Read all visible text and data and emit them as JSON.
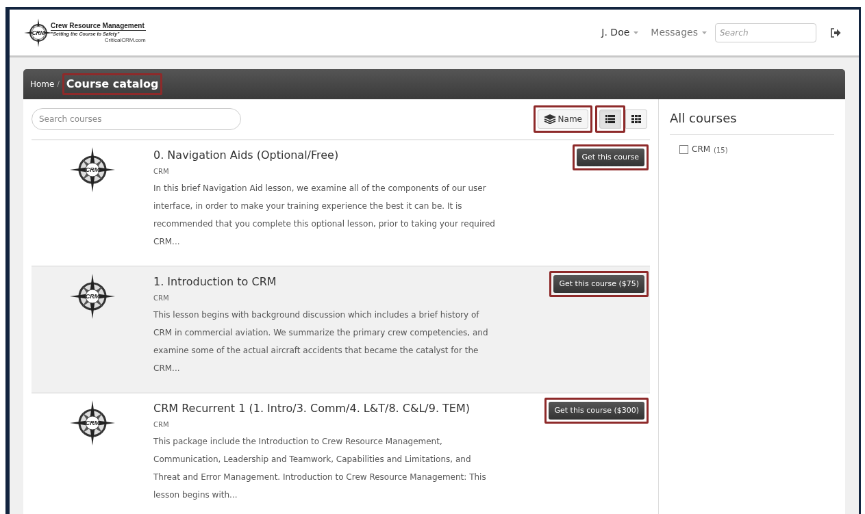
{
  "logo": {
    "title": "Crew Resource Management",
    "tagline": "\"Setting the Course to Safety\"",
    "site": "CriticalCRM.com",
    "emblem": "CRM"
  },
  "nav": {
    "user": "J. Doe",
    "messages": "Messages",
    "search": {
      "placeholder": "Search"
    }
  },
  "breadcrumb": [
    {
      "label": "Home",
      "highlighted": false
    },
    {
      "label": "Course catalog",
      "highlighted": true
    }
  ],
  "breadcrumb_separator": "/",
  "search_courses": {
    "placeholder": "Search courses"
  },
  "sort_button": {
    "label": "Name",
    "highlighted": true
  },
  "view_toggle": [
    {
      "kind": "list",
      "selected": true,
      "highlighted": true
    },
    {
      "kind": "grid",
      "selected": false,
      "highlighted": false
    }
  ],
  "courses": [
    {
      "title": "0. Navigation Aids (Optional/Free)",
      "category": "CRM",
      "emblem": "CRM",
      "description": "In this brief Navigation Aid lesson, we examine all of the components of our user interface, in order to make your training experience the best it can be. It is recommended that you complete this optional lesson, prior to taking your required CRM...",
      "button": "Get this course",
      "highlighted": true,
      "hovered": false
    },
    {
      "title": "1. Introduction to CRM",
      "category": "CRM",
      "emblem": "CRM",
      "description": "This lesson begins with background discussion which includes a brief history of CRM in commercial aviation. We summarize the primary crew competencies, and examine some of the actual aircraft accidents that became the catalyst for the CRM...",
      "button": "Get this course ($75)",
      "highlighted": true,
      "hovered": true
    },
    {
      "title": "CRM Recurrent 1 (1. Intro/3. Comm/4. L&T/8. C&L/9. TEM)",
      "category": "CRM",
      "emblem": "CRM",
      "description": "This package include the Introduction to Crew Resource Management, Communication, Leadership and Teamwork, Capabilities and Limitations, and Threat and Error Management. Introduction to Crew Resource Management: This lesson begins with...",
      "button": "Get this course ($300)",
      "highlighted": true,
      "hovered": false
    }
  ],
  "sidebar": {
    "title": "All courses",
    "filters": [
      {
        "label": "CRM",
        "count": "(15)",
        "checked": false
      }
    ]
  }
}
